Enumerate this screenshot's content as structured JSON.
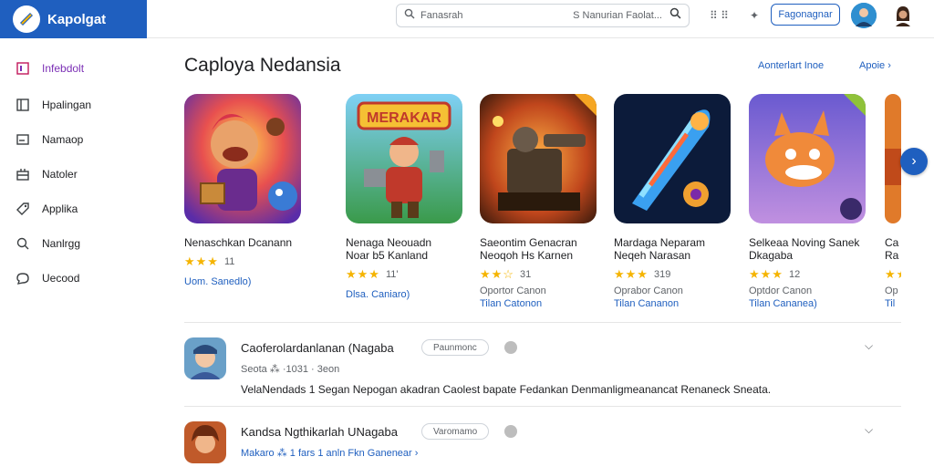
{
  "brand": {
    "title": "Kapolgat"
  },
  "search": {
    "placeholder": "Fanasrah",
    "secondary": "S Nanurian Faolat..."
  },
  "topbar": {
    "more_label": "⠿ ⠿",
    "sparkle_label": "✦",
    "action_button": "Fagonagnar"
  },
  "sidebar": {
    "items": [
      {
        "label": "Infebdolt",
        "icon": "home-icon",
        "active": true
      },
      {
        "label": "Hpalingan",
        "icon": "library-icon"
      },
      {
        "label": "Namaop",
        "icon": "window-icon"
      },
      {
        "label": "Natoler",
        "icon": "grid-icon"
      },
      {
        "label": "Applika",
        "icon": "tag-icon"
      },
      {
        "label": "Nanlrgg",
        "icon": "search-icon"
      },
      {
        "label": "Uecood",
        "icon": "chat-icon"
      }
    ]
  },
  "section": {
    "title": "Caploya Nedansia",
    "more_link": "Aonterlart Inoe",
    "apps_link": "Apoie ›"
  },
  "cards": [
    {
      "name": "Nenaschkan Dcanann",
      "name2": "",
      "stars": "★★★",
      "rating": "11",
      "meta1": "",
      "meta2": "Uom. Sanedlo)"
    },
    {
      "name": "Nenaga Neouadn",
      "name2": "Noar b5 Kanland",
      "stars": "★★★",
      "rating": "11'",
      "meta1": "",
      "meta2": "Dlsa. Caniaro)"
    },
    {
      "name": "Saeontim Genacran",
      "name2": "Neoqoh Hs Karnen",
      "stars": "★★☆",
      "rating": "31",
      "meta1": "Oportor Canon",
      "meta2": "Tilan Catonon"
    },
    {
      "name": "Mardaga Neparam",
      "name2": "Neqeh Narasan",
      "stars": "★★★",
      "rating": "319",
      "meta1": "Oprabor Canon",
      "meta2": "Tilan Cananon"
    },
    {
      "name": "Selkeaa Noving Sanek",
      "name2": "Dkagaba",
      "stars": "★★★",
      "rating": "12",
      "meta1": "Optdor Canon",
      "meta2": "Tilan Cananea)"
    },
    {
      "name": "Ca",
      "name2": "Ra",
      "stars": "★★",
      "rating": "",
      "meta1": "Op",
      "meta2": "Til"
    }
  ],
  "list": [
    {
      "title": "Caoferolardanlanan (Nagaba",
      "pill": "Paunmonc",
      "sub": "Seota ⁂ ·1031 · 3eon",
      "desc": "VelaNendads 1 Segan Nepogan akadran Caolest bapate Fedankan Denmanligmeanancat Renaneck Sneata."
    },
    {
      "title": "Kandsa Ngthikarlah UNagaba",
      "pill": "Varomamo",
      "sub": "Makaro ⁂ 1 fars 1 anln  Fkn Ganenear ›",
      "desc": ""
    }
  ]
}
